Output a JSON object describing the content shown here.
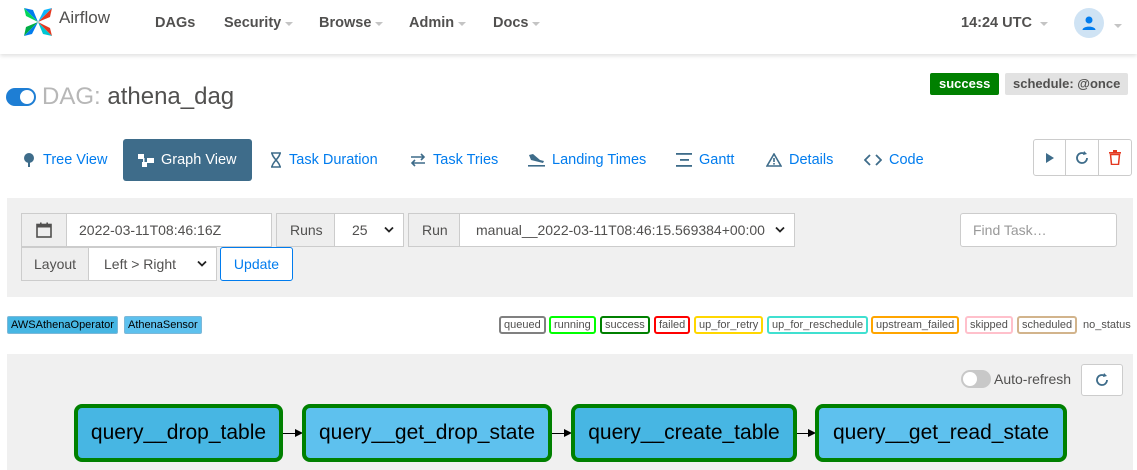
{
  "navbar": {
    "brand": "Airflow",
    "menu": [
      {
        "label": "DAGs",
        "dropdown": false
      },
      {
        "label": "Security",
        "dropdown": true
      },
      {
        "label": "Browse",
        "dropdown": true
      },
      {
        "label": "Admin",
        "dropdown": true
      },
      {
        "label": "Docs",
        "dropdown": true
      }
    ],
    "time": "14:24 UTC",
    "user_icon": "user-icon"
  },
  "dag": {
    "prefix": "DAG:",
    "name": "athena_dag",
    "paused": false,
    "status": "success",
    "schedule": "schedule: @once"
  },
  "tabs": [
    {
      "label": "Tree View",
      "icon": "tree-icon",
      "active": false
    },
    {
      "label": "Graph View",
      "icon": "graph-icon",
      "active": true
    },
    {
      "label": "Task Duration",
      "icon": "hourglass-icon",
      "active": false
    },
    {
      "label": "Task Tries",
      "icon": "retry-icon",
      "active": false
    },
    {
      "label": "Landing Times",
      "icon": "landing-icon",
      "active": false
    },
    {
      "label": "Gantt",
      "icon": "gantt-icon",
      "active": false
    },
    {
      "label": "Details",
      "icon": "details-icon",
      "active": false
    },
    {
      "label": "Code",
      "icon": "code-icon",
      "active": false
    }
  ],
  "actions": [
    "play-icon",
    "refresh-icon",
    "trash-icon"
  ],
  "filters": {
    "base_date": "2022-03-11T08:46:16Z",
    "runs_label": "Runs",
    "runs_value": "25",
    "run_label": "Run",
    "run_value": "manual__2022-03-11T08:46:15.569384+00:00",
    "find_placeholder": "Find Task…",
    "layout_label": "Layout",
    "layout_value": "Left > Right",
    "update_label": "Update"
  },
  "operators": [
    {
      "label": "AWSAthenaOperator",
      "color": "#47b6e3"
    },
    {
      "label": "AthenaSensor",
      "color": "#5ec1ee"
    }
  ],
  "states": [
    {
      "label": "queued",
      "color": "#808080"
    },
    {
      "label": "running",
      "color": "#00ff00"
    },
    {
      "label": "success",
      "color": "#008000"
    },
    {
      "label": "failed",
      "color": "#ff0000"
    },
    {
      "label": "up_for_retry",
      "color": "#ffd700"
    },
    {
      "label": "up_for_reschedule",
      "color": "#40e0d0"
    },
    {
      "label": "upstream_failed",
      "color": "#ffa500"
    },
    {
      "label": "skipped",
      "color": "#ffc0cb"
    },
    {
      "label": "scheduled",
      "color": "#d2b48c"
    },
    {
      "label": "no_status",
      "color": null
    }
  ],
  "graph": {
    "auto_refresh_label": "Auto-refresh",
    "auto_refresh": false,
    "tasks": [
      {
        "label": "query__drop_table",
        "operator": "AWSAthenaOperator",
        "state": "success"
      },
      {
        "label": "query__get_drop_state",
        "operator": "AthenaSensor",
        "state": "success"
      },
      {
        "label": "query__create_table",
        "operator": "AWSAthenaOperator",
        "state": "success"
      },
      {
        "label": "query__get_read_state",
        "operator": "AthenaSensor",
        "state": "success"
      }
    ]
  }
}
